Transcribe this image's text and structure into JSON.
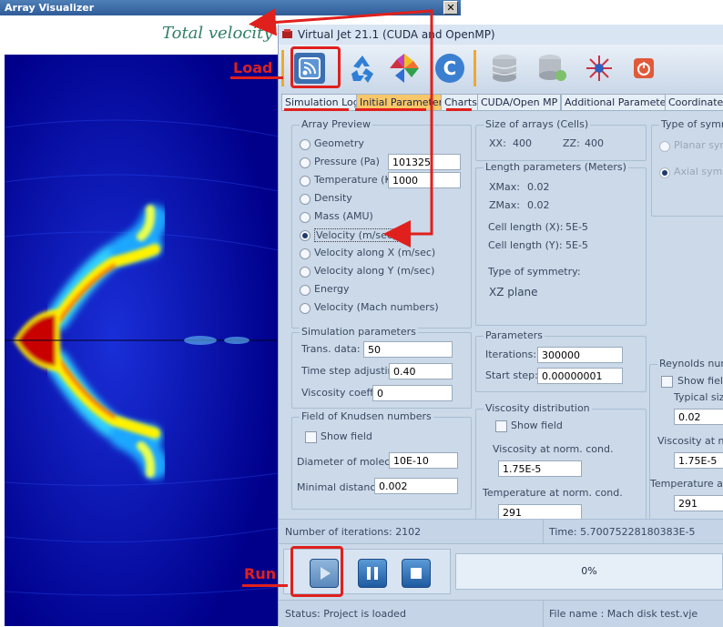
{
  "visualizer": {
    "title": "Array Visualizer",
    "close_glyph": "✕",
    "caption": "Total velocity"
  },
  "app": {
    "title": "Virtual Jet 21.1 (CUDA and OpenMP)",
    "toolbar_icons": [
      "load-icon",
      "recycle-icon",
      "pinwheel-icon",
      "c-icon",
      "database-icon",
      "database-refresh-icon",
      "settings-spark-icon",
      "power-icon"
    ],
    "tabs": [
      "Simulation Log",
      "Initial Parameters",
      "Charts",
      "CUDA/Open MP",
      "Additional Parameters",
      "Coordinates"
    ],
    "active_tab": "Initial Parameters",
    "array_preview": {
      "title": "Array Preview",
      "options": [
        "Geometry",
        "Pressure (Pa)",
        "Temperature (K)",
        "Density",
        "Mass (AMU)",
        "Velocity (m/sec)",
        "Velocity along X (m/sec)",
        "Velocity along Y (m/sec)",
        "Energy",
        "Velocity (Mach numbers)"
      ],
      "selected": "Velocity (m/sec)",
      "pressure_value": "101325",
      "temperature_value": "1000"
    },
    "size_of_arrays": {
      "title": "Size of arrays (Cells)",
      "xx_label": "XX:",
      "xx_value": "400",
      "zz_label": "ZZ:",
      "zz_value": "400"
    },
    "length_parameters": {
      "title": "Length parameters (Meters)",
      "xmax_label": "XMax:",
      "xmax_value": "0.02",
      "zmax_label": "ZMax:",
      "zmax_value": "0.02",
      "cell_x_label": "Cell length (X):",
      "cell_x_value": "5E-5",
      "cell_y_label": "Cell length (Y):",
      "cell_y_value": "5E-5",
      "symmetry_label": "Type of symmetry:",
      "symmetry_value": "XZ plane"
    },
    "type_of_symmetry": {
      "title": "Type of symme",
      "planar": "Planar symm",
      "axial": "Axial symme"
    },
    "simulation_parameters": {
      "title": "Simulation parameters",
      "trans_label": "Trans. data:",
      "trans_value": "50",
      "timestep_label": "Time step adjusting:",
      "timestep_value": "0.40",
      "viscosity_label": "Viscosity coeff.:",
      "viscosity_value": "0"
    },
    "parameters": {
      "title": "Parameters",
      "iterations_label": "Iterations:",
      "iterations_value": "300000",
      "start_label": "Start step:",
      "start_value": "0.00000001"
    },
    "reynolds": {
      "title": "Reynolds numb",
      "show_field": "Show field",
      "typical_size": "Typical siz",
      "typical_value": "0.02",
      "visc_label": "Viscosity at n",
      "visc_value": "1.75E-5",
      "temp_label": "Temperature at n",
      "temp_value": "291"
    },
    "knudsen": {
      "title": "Field of Knudsen numbers",
      "show_field": "Show field",
      "diameter_label": "Diameter of molecule:",
      "diameter_value": "10E-10",
      "distance_label": "Minimal distance:",
      "distance_value": "0.002"
    },
    "viscosity_distribution": {
      "title": "Viscosity distribution",
      "show_field": "Show field",
      "visc_label": "Viscosity at norm. cond.",
      "visc_value": "1.75E-5",
      "temp_label": "Temperature at norm. cond.",
      "temp_value": "291"
    },
    "iterations_status": "Number of iterations: 2102",
    "time_status": "Time: 5.70075228180383E-5",
    "progress_text": "0%",
    "status_text": "Status: Project is loaded",
    "file_name": "File name : Mach disk test.vje"
  },
  "annotations": {
    "load": "Load",
    "run": "Run",
    "color": "#e0201c"
  }
}
